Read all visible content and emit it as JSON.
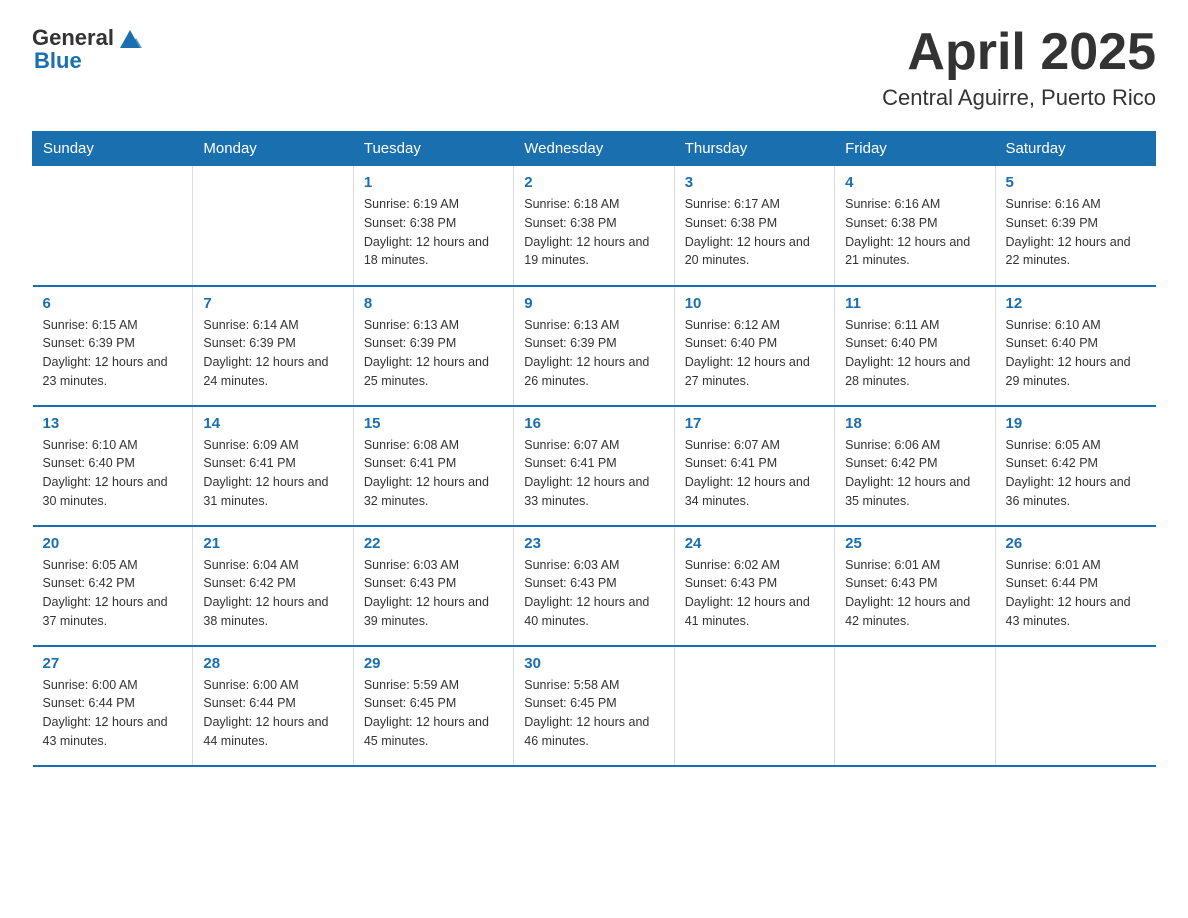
{
  "logo": {
    "text_general": "General",
    "text_blue": "Blue"
  },
  "title": "April 2025",
  "subtitle": "Central Aguirre, Puerto Rico",
  "weekdays": [
    "Sunday",
    "Monday",
    "Tuesday",
    "Wednesday",
    "Thursday",
    "Friday",
    "Saturday"
  ],
  "weeks": [
    [
      {
        "day": "",
        "sunrise": "",
        "sunset": "",
        "daylight": ""
      },
      {
        "day": "",
        "sunrise": "",
        "sunset": "",
        "daylight": ""
      },
      {
        "day": "1",
        "sunrise": "Sunrise: 6:19 AM",
        "sunset": "Sunset: 6:38 PM",
        "daylight": "Daylight: 12 hours and 18 minutes."
      },
      {
        "day": "2",
        "sunrise": "Sunrise: 6:18 AM",
        "sunset": "Sunset: 6:38 PM",
        "daylight": "Daylight: 12 hours and 19 minutes."
      },
      {
        "day": "3",
        "sunrise": "Sunrise: 6:17 AM",
        "sunset": "Sunset: 6:38 PM",
        "daylight": "Daylight: 12 hours and 20 minutes."
      },
      {
        "day": "4",
        "sunrise": "Sunrise: 6:16 AM",
        "sunset": "Sunset: 6:38 PM",
        "daylight": "Daylight: 12 hours and 21 minutes."
      },
      {
        "day": "5",
        "sunrise": "Sunrise: 6:16 AM",
        "sunset": "Sunset: 6:39 PM",
        "daylight": "Daylight: 12 hours and 22 minutes."
      }
    ],
    [
      {
        "day": "6",
        "sunrise": "Sunrise: 6:15 AM",
        "sunset": "Sunset: 6:39 PM",
        "daylight": "Daylight: 12 hours and 23 minutes."
      },
      {
        "day": "7",
        "sunrise": "Sunrise: 6:14 AM",
        "sunset": "Sunset: 6:39 PM",
        "daylight": "Daylight: 12 hours and 24 minutes."
      },
      {
        "day": "8",
        "sunrise": "Sunrise: 6:13 AM",
        "sunset": "Sunset: 6:39 PM",
        "daylight": "Daylight: 12 hours and 25 minutes."
      },
      {
        "day": "9",
        "sunrise": "Sunrise: 6:13 AM",
        "sunset": "Sunset: 6:39 PM",
        "daylight": "Daylight: 12 hours and 26 minutes."
      },
      {
        "day": "10",
        "sunrise": "Sunrise: 6:12 AM",
        "sunset": "Sunset: 6:40 PM",
        "daylight": "Daylight: 12 hours and 27 minutes."
      },
      {
        "day": "11",
        "sunrise": "Sunrise: 6:11 AM",
        "sunset": "Sunset: 6:40 PM",
        "daylight": "Daylight: 12 hours and 28 minutes."
      },
      {
        "day": "12",
        "sunrise": "Sunrise: 6:10 AM",
        "sunset": "Sunset: 6:40 PM",
        "daylight": "Daylight: 12 hours and 29 minutes."
      }
    ],
    [
      {
        "day": "13",
        "sunrise": "Sunrise: 6:10 AM",
        "sunset": "Sunset: 6:40 PM",
        "daylight": "Daylight: 12 hours and 30 minutes."
      },
      {
        "day": "14",
        "sunrise": "Sunrise: 6:09 AM",
        "sunset": "Sunset: 6:41 PM",
        "daylight": "Daylight: 12 hours and 31 minutes."
      },
      {
        "day": "15",
        "sunrise": "Sunrise: 6:08 AM",
        "sunset": "Sunset: 6:41 PM",
        "daylight": "Daylight: 12 hours and 32 minutes."
      },
      {
        "day": "16",
        "sunrise": "Sunrise: 6:07 AM",
        "sunset": "Sunset: 6:41 PM",
        "daylight": "Daylight: 12 hours and 33 minutes."
      },
      {
        "day": "17",
        "sunrise": "Sunrise: 6:07 AM",
        "sunset": "Sunset: 6:41 PM",
        "daylight": "Daylight: 12 hours and 34 minutes."
      },
      {
        "day": "18",
        "sunrise": "Sunrise: 6:06 AM",
        "sunset": "Sunset: 6:42 PM",
        "daylight": "Daylight: 12 hours and 35 minutes."
      },
      {
        "day": "19",
        "sunrise": "Sunrise: 6:05 AM",
        "sunset": "Sunset: 6:42 PM",
        "daylight": "Daylight: 12 hours and 36 minutes."
      }
    ],
    [
      {
        "day": "20",
        "sunrise": "Sunrise: 6:05 AM",
        "sunset": "Sunset: 6:42 PM",
        "daylight": "Daylight: 12 hours and 37 minutes."
      },
      {
        "day": "21",
        "sunrise": "Sunrise: 6:04 AM",
        "sunset": "Sunset: 6:42 PM",
        "daylight": "Daylight: 12 hours and 38 minutes."
      },
      {
        "day": "22",
        "sunrise": "Sunrise: 6:03 AM",
        "sunset": "Sunset: 6:43 PM",
        "daylight": "Daylight: 12 hours and 39 minutes."
      },
      {
        "day": "23",
        "sunrise": "Sunrise: 6:03 AM",
        "sunset": "Sunset: 6:43 PM",
        "daylight": "Daylight: 12 hours and 40 minutes."
      },
      {
        "day": "24",
        "sunrise": "Sunrise: 6:02 AM",
        "sunset": "Sunset: 6:43 PM",
        "daylight": "Daylight: 12 hours and 41 minutes."
      },
      {
        "day": "25",
        "sunrise": "Sunrise: 6:01 AM",
        "sunset": "Sunset: 6:43 PM",
        "daylight": "Daylight: 12 hours and 42 minutes."
      },
      {
        "day": "26",
        "sunrise": "Sunrise: 6:01 AM",
        "sunset": "Sunset: 6:44 PM",
        "daylight": "Daylight: 12 hours and 43 minutes."
      }
    ],
    [
      {
        "day": "27",
        "sunrise": "Sunrise: 6:00 AM",
        "sunset": "Sunset: 6:44 PM",
        "daylight": "Daylight: 12 hours and 43 minutes."
      },
      {
        "day": "28",
        "sunrise": "Sunrise: 6:00 AM",
        "sunset": "Sunset: 6:44 PM",
        "daylight": "Daylight: 12 hours and 44 minutes."
      },
      {
        "day": "29",
        "sunrise": "Sunrise: 5:59 AM",
        "sunset": "Sunset: 6:45 PM",
        "daylight": "Daylight: 12 hours and 45 minutes."
      },
      {
        "day": "30",
        "sunrise": "Sunrise: 5:58 AM",
        "sunset": "Sunset: 6:45 PM",
        "daylight": "Daylight: 12 hours and 46 minutes."
      },
      {
        "day": "",
        "sunrise": "",
        "sunset": "",
        "daylight": ""
      },
      {
        "day": "",
        "sunrise": "",
        "sunset": "",
        "daylight": ""
      },
      {
        "day": "",
        "sunrise": "",
        "sunset": "",
        "daylight": ""
      }
    ]
  ],
  "colors": {
    "header_bg": "#1a6faf",
    "header_text": "#ffffff",
    "day_number": "#1a6faf",
    "border": "#1a6faf"
  }
}
